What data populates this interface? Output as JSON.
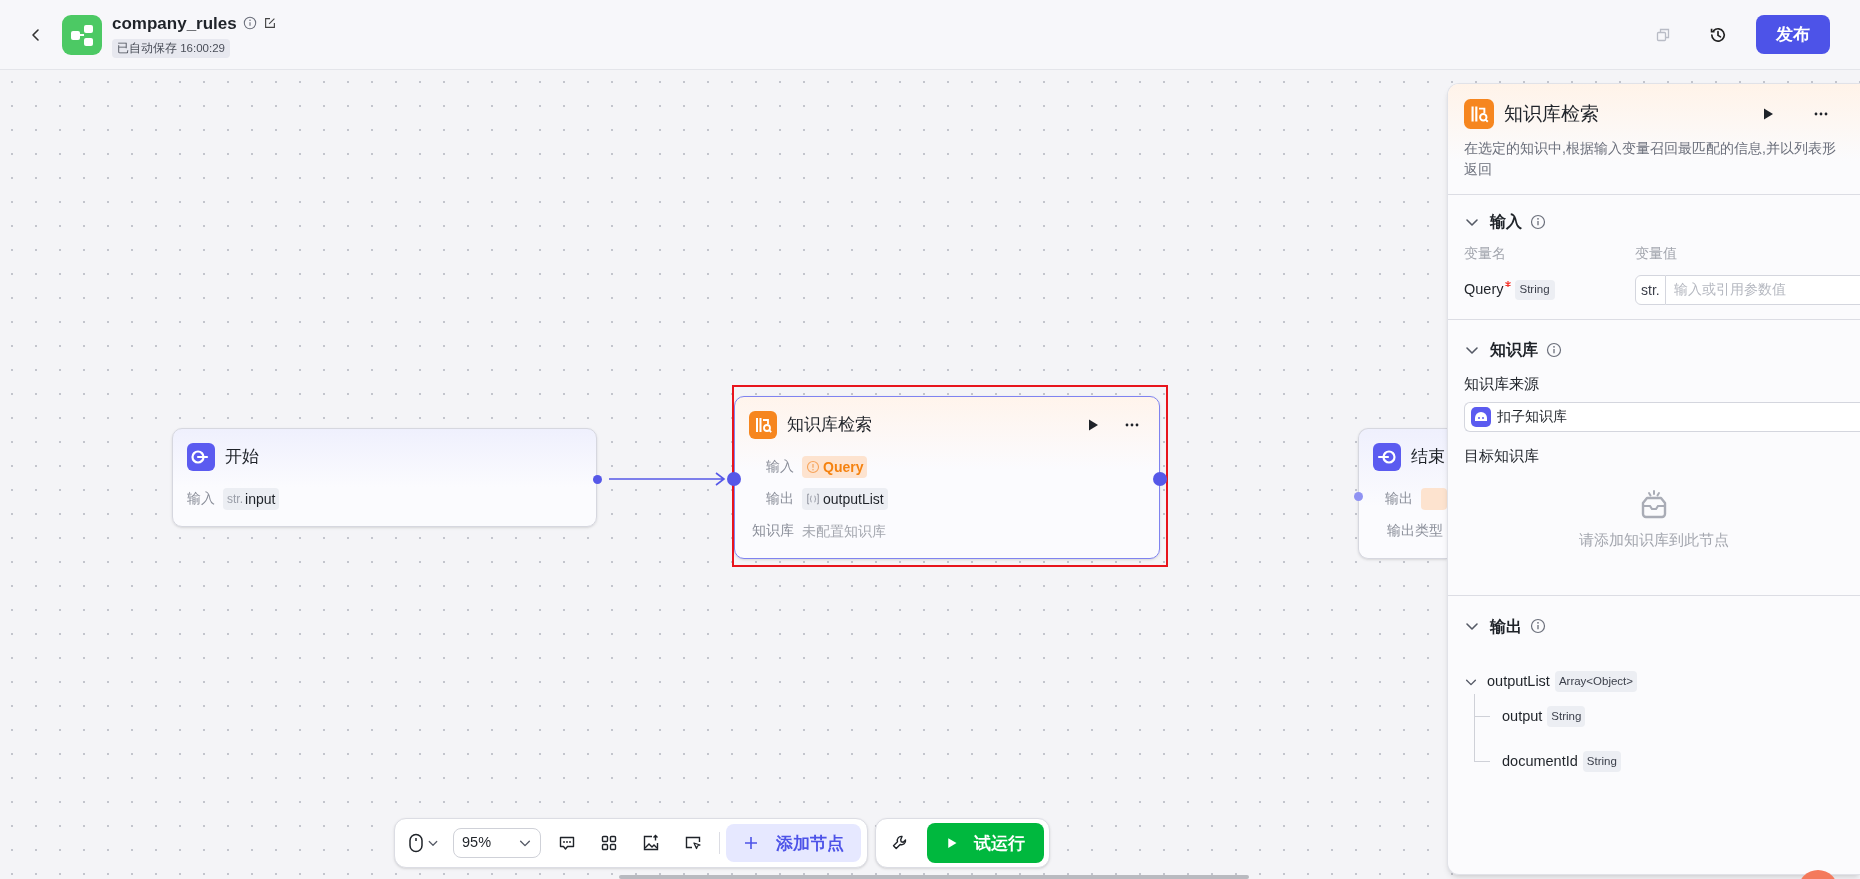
{
  "header": {
    "title": "company_rules",
    "autosave": "已自动保存 16:00:29",
    "publish_button": "发布"
  },
  "canvas": {
    "nodes": [
      {
        "kind": "start",
        "title": "开始",
        "highlighted": false,
        "rows": [
          {
            "label": "输入",
            "kind": "string",
            "tag": "str.",
            "value": "input"
          }
        ]
      },
      {
        "kind": "knowledge",
        "title": "知识库检索",
        "highlighted": true,
        "rows": [
          {
            "label": "输入",
            "kind": "warning",
            "value": "Query"
          },
          {
            "label": "输出",
            "kind": "array",
            "value": "outputList"
          },
          {
            "label": "知识库",
            "kind": "plain",
            "value": "未配置知识库"
          }
        ]
      },
      {
        "kind": "end",
        "title": "结束",
        "highlighted": false,
        "rows": [
          {
            "label": "输出",
            "kind": "warning"
          },
          {
            "label": "输出类型",
            "kind": "plain"
          }
        ]
      }
    ]
  },
  "panel": {
    "title": "知识库检索",
    "description": [
      "在选定的知识中,根据输入变量召回最匹配的信息,并以列表形",
      "返回"
    ],
    "sections": [
      {
        "kind": "inputs",
        "title": "输入",
        "expanded": true,
        "columns": [
          "变量名",
          "变量值"
        ],
        "params": [
          {
            "name": "Query",
            "required": true,
            "type": "String",
            "tag": "str.",
            "placeholder": "输入或引用参数值"
          }
        ]
      },
      {
        "kind": "knowledge",
        "title": "知识库",
        "expanded": true,
        "source_label": "知识库来源",
        "source": "扣子知识库",
        "target_label": "目标知识库",
        "empty_text": "请添加知识库到此节点"
      },
      {
        "kind": "outputs",
        "title": "输出",
        "expanded": true,
        "tree": [
          {
            "name": "outputList",
            "type": "Array<Object>",
            "expanded": true,
            "children": [
              {
                "name": "output",
                "type": "String"
              },
              {
                "name": "documentId",
                "type": "String"
              }
            ]
          }
        ]
      }
    ]
  },
  "toolbar": {
    "zoom": "95%",
    "add_node": "添加节点",
    "run": "试运行"
  }
}
